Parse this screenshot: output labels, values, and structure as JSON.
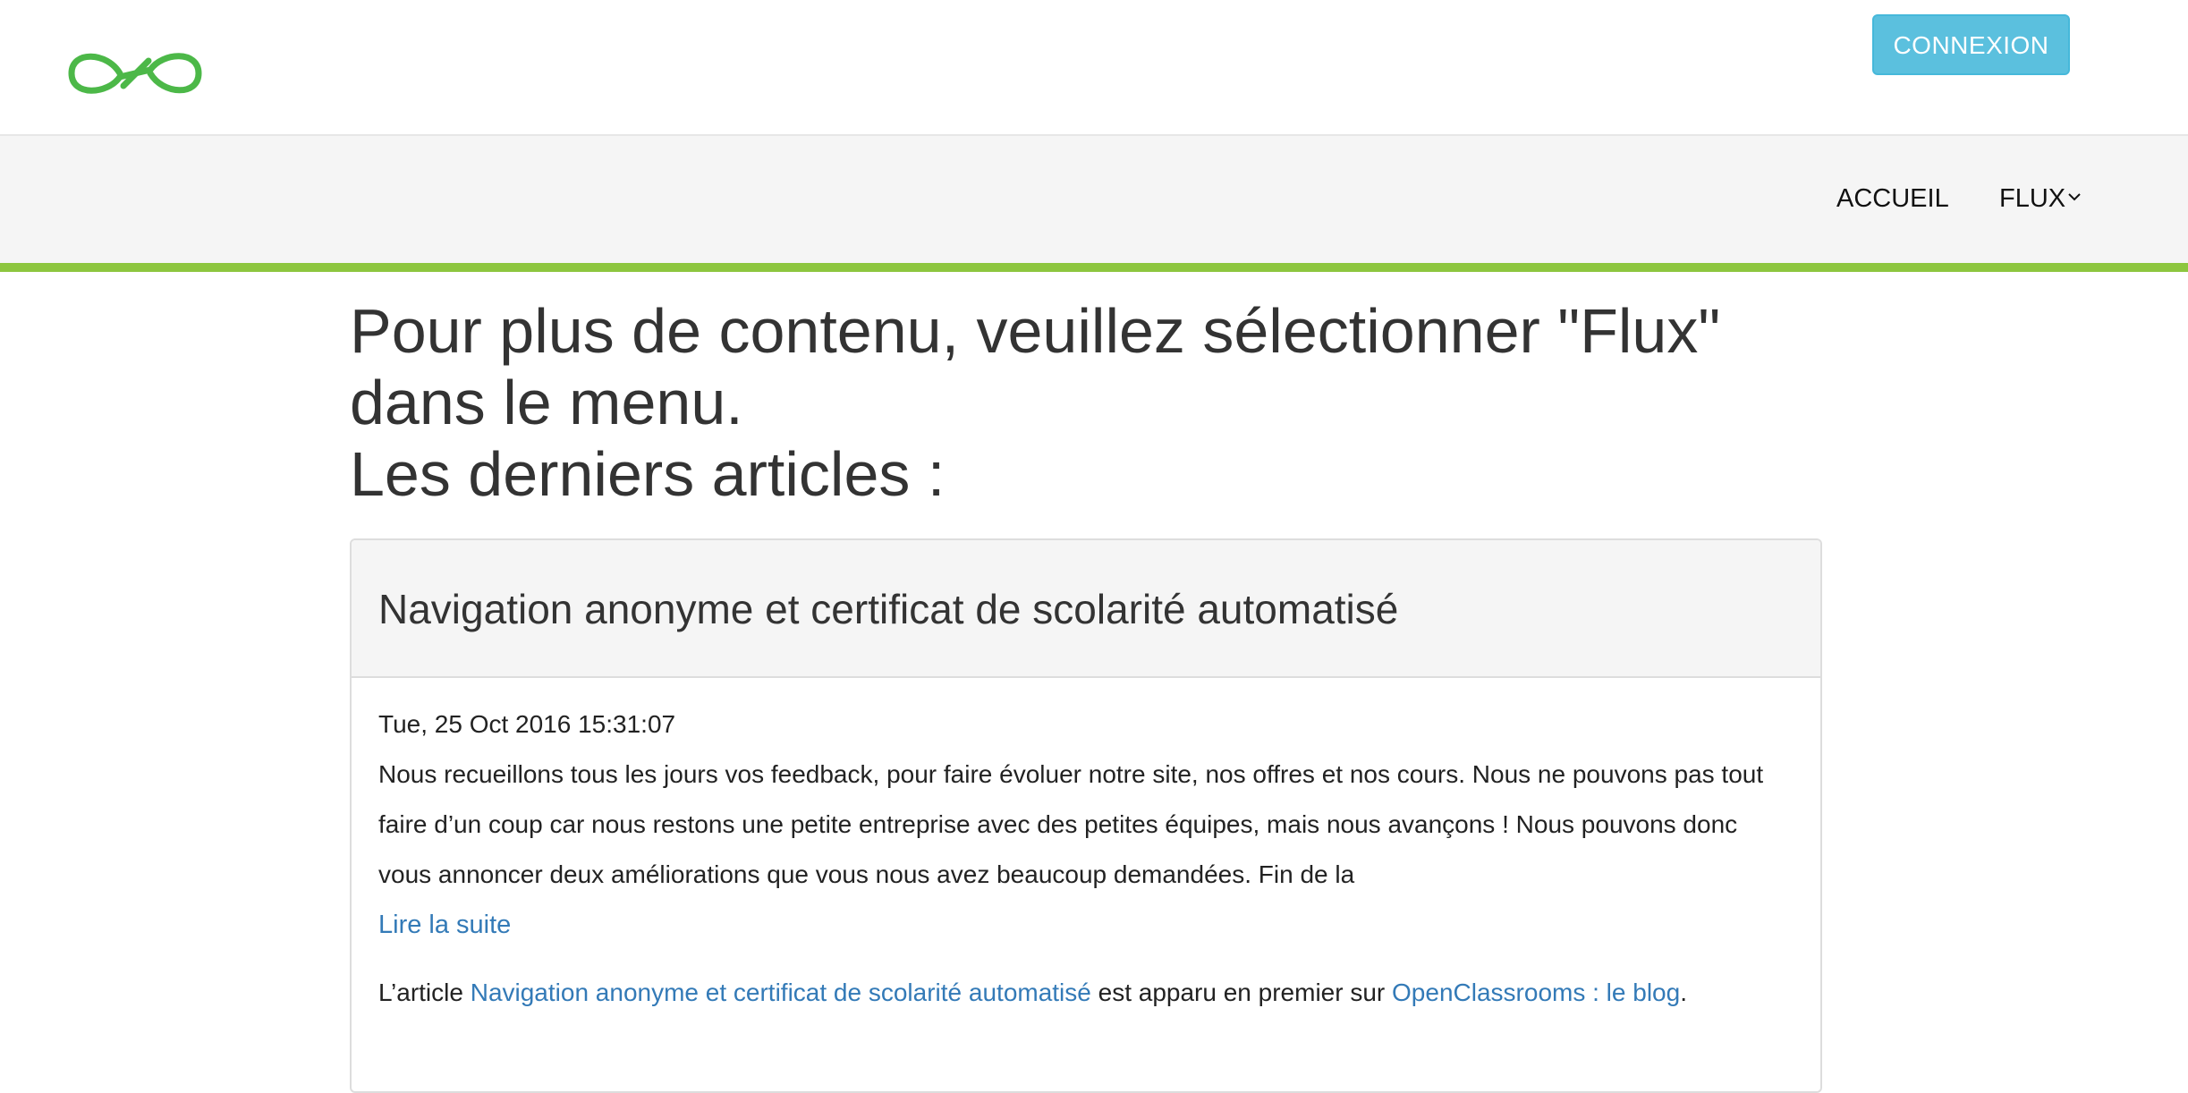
{
  "header": {
    "logo_icon": "infinity-logo-icon",
    "login_label": "CONNEXION",
    "accent_color": "#8dc63f",
    "button_color": "#5bc0de",
    "link_color": "#337ab7"
  },
  "nav": {
    "items": [
      {
        "label": "ACCUEIL"
      },
      {
        "label": "FLUX",
        "icon": "chevron-down-icon"
      }
    ]
  },
  "intro": {
    "line1": "Pour plus de contenu, veuillez sélectionner \"Flux\" dans le menu.",
    "line2": "Les derniers articles :"
  },
  "article": {
    "title": "Navigation anonyme et certificat de scolarité automatisé",
    "date": "Tue, 25 Oct 2016 15:31:07",
    "excerpt": "Nous recueillons tous les jours vos feedback, pour faire évoluer notre site, nos offres et nos cours. Nous ne pouvons pas tout faire d’un coup car nous restons une petite entreprise avec des petites équipes, mais nous avançons ! Nous pouvons donc vous annoncer deux améliorations que vous nous avez beaucoup demandées. Fin de la",
    "read_more": "Lire la suite",
    "footnote": {
      "prefix": "L’article ",
      "article_link": "Navigation anonyme et certificat de scolarité automatisé",
      "middle": " est apparu en premier sur ",
      "blog_link": "OpenClassrooms : le blog",
      "suffix": "."
    }
  }
}
